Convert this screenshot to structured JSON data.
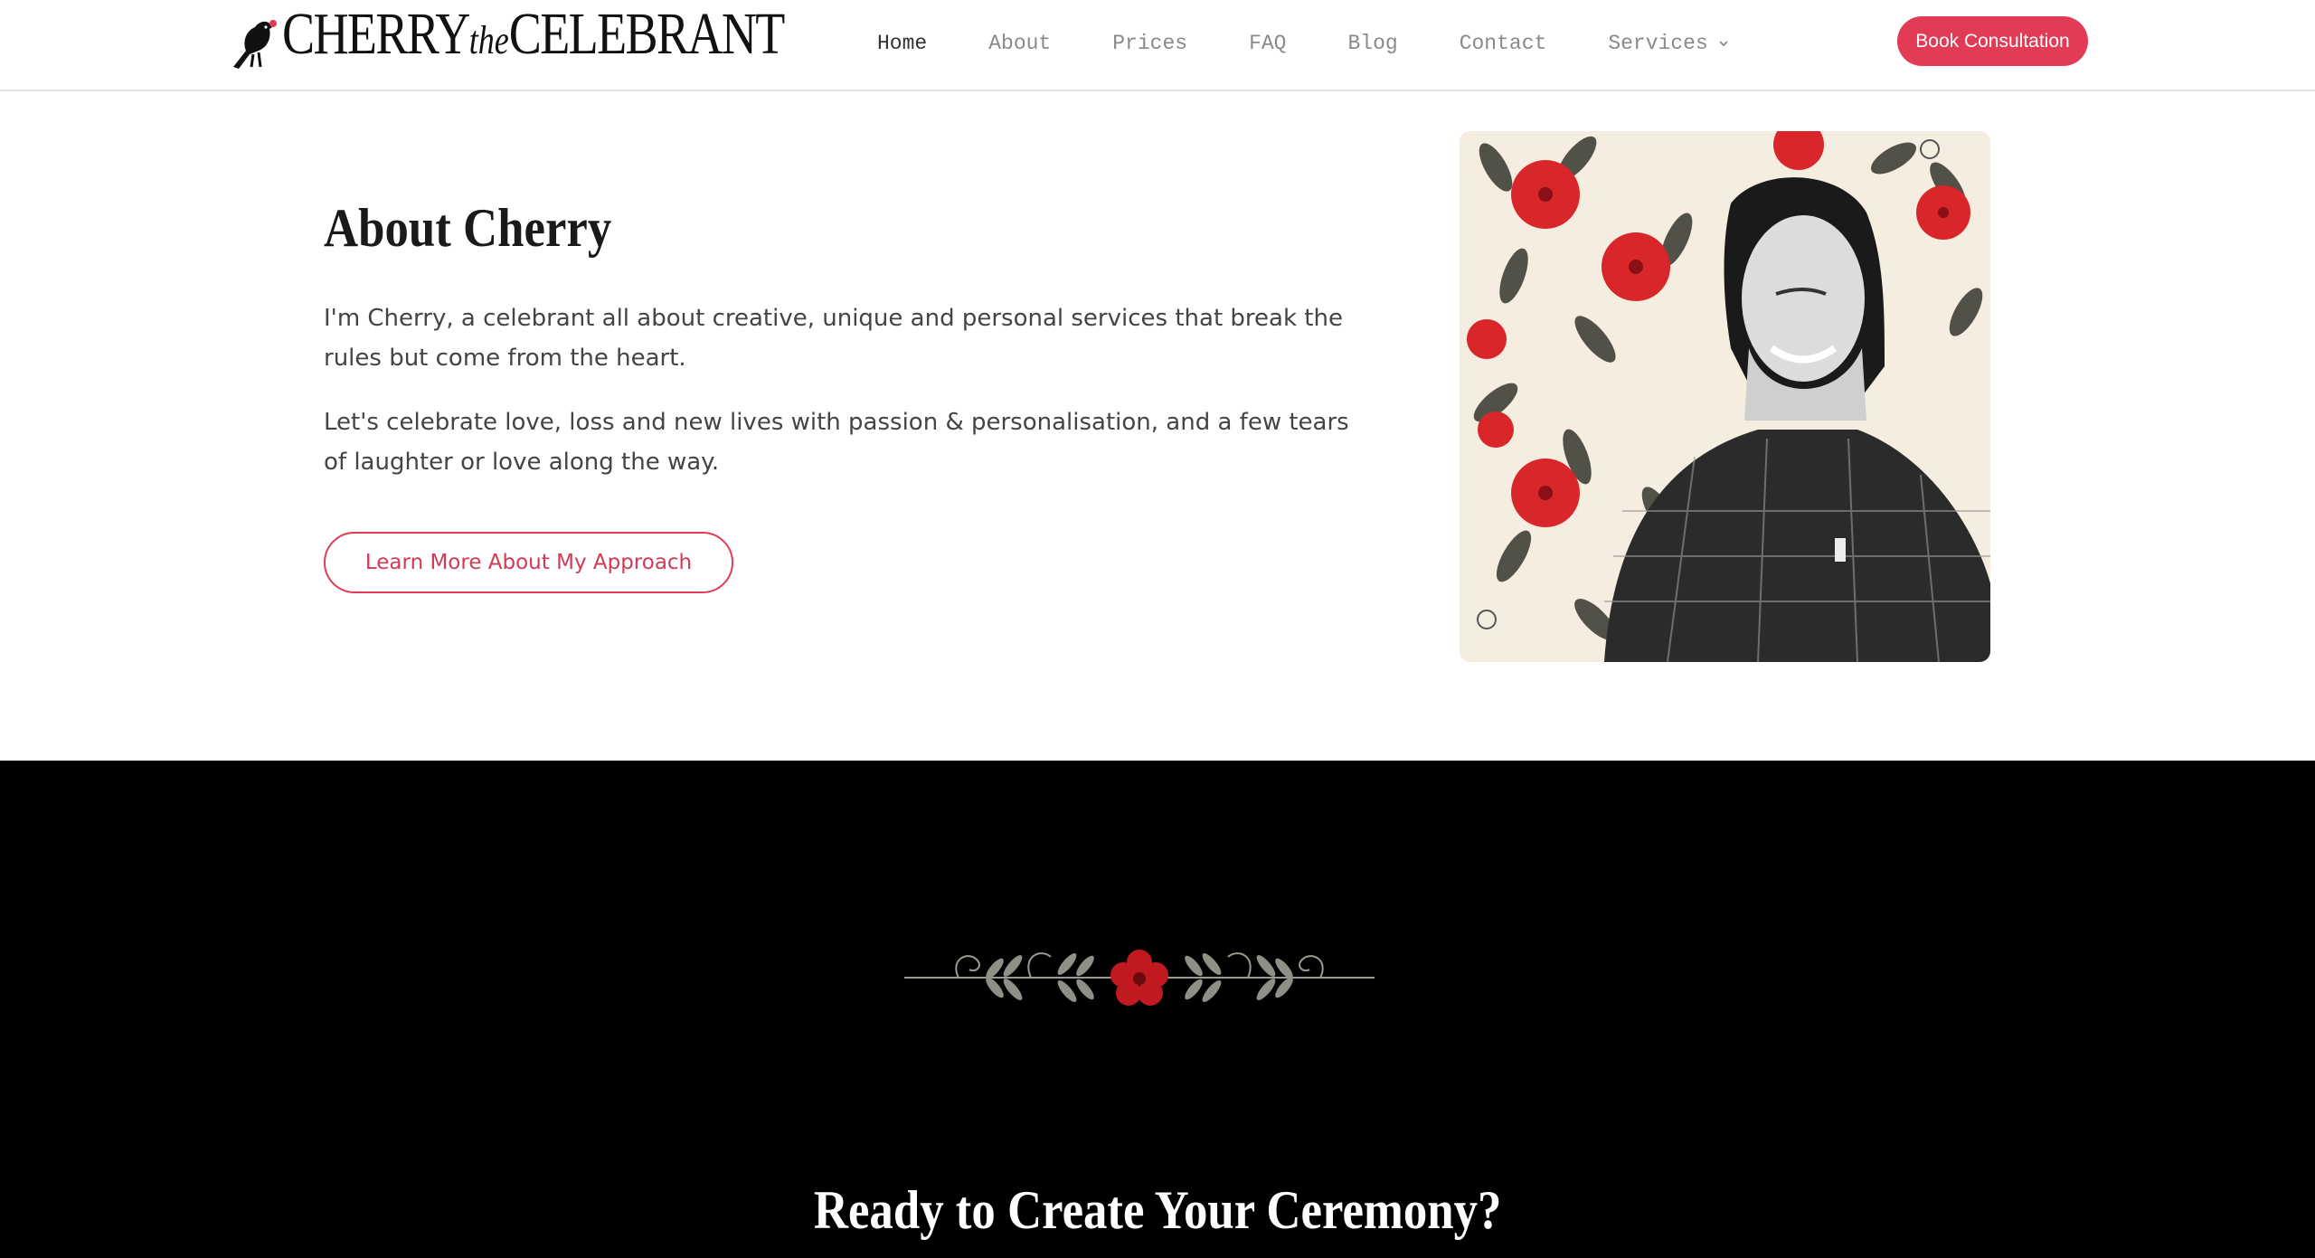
{
  "header": {
    "logo": {
      "main": "CHERRY",
      "middle": "the",
      "end": "CELEBRANT"
    },
    "nav": [
      {
        "label": "Home",
        "active": true
      },
      {
        "label": "About",
        "active": false
      },
      {
        "label": "Prices",
        "active": false
      },
      {
        "label": "FAQ",
        "active": false
      },
      {
        "label": "Blog",
        "active": false
      },
      {
        "label": "Contact",
        "active": false
      },
      {
        "label": "Services",
        "active": false,
        "has_dropdown": true
      }
    ],
    "cta_label": "Book Consultation"
  },
  "about": {
    "title": "About Cherry",
    "paragraph1": "I'm Cherry, a celebrant all about creative, unique and personal services that break the rules but come from the heart.",
    "paragraph2": "Let's celebrate love, loss and new lives with passion & personalisation, and a few tears of laughter or love along the way.",
    "button_label": "Learn More About My Approach"
  },
  "cta_section": {
    "title": "Ready to Create Your Ceremony?"
  },
  "colors": {
    "accent": "#e23b55",
    "dark_bg": "#000000",
    "flower_red": "#d8262b"
  },
  "icons": [
    "magpie-bird-icon",
    "chevron-down-icon",
    "floral-divider-ornament"
  ]
}
